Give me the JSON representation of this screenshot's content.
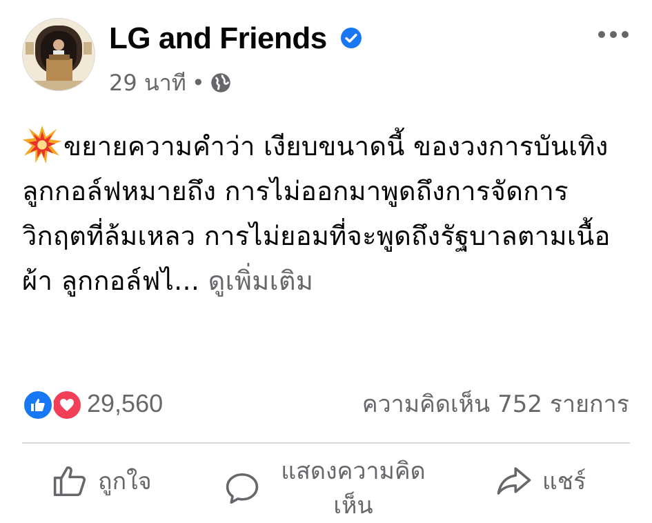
{
  "post": {
    "page_name": "LG and Friends",
    "time": "29 นาที",
    "separator": "•",
    "body": "ขยายความคำว่า เงียบขนาดนี้ ของวงการบันเทิง ลูกกอล์ฟหมายถึง การไม่ออกมาพูดถึงการจัดการวิกฤตที่ล้มเหลว การไม่ยอมที่จะพูดถึงรัฐบาลตามเนื้อผ้า ลูกกอล์ฟไ... ",
    "see_more": "ดูเพิ่มเติม",
    "reaction_count": "29,560",
    "comment_count": "ความคิดเห็น 752 รายการ"
  },
  "actions": {
    "like": "ถูกใจ",
    "comment": "แสดงความคิดเห็น",
    "share": "แชร์"
  },
  "colors": {
    "verified": "#1877f2",
    "like": "#1877f2",
    "love": "#f33e58",
    "secondary_text": "#65676b"
  },
  "icons": [
    "verified-icon",
    "globe-icon",
    "more-options-icon",
    "explosion-emoji-icon",
    "like-reaction-icon",
    "love-reaction-icon",
    "like-thumb-icon",
    "comment-bubble-icon",
    "share-arrow-icon"
  ]
}
